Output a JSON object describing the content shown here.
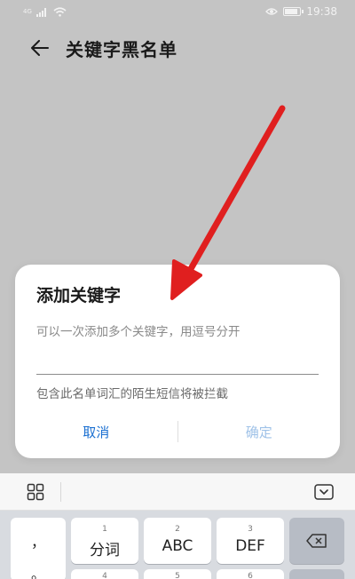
{
  "status_bar": {
    "time": "19:38",
    "signal_label": "4G"
  },
  "header": {
    "title": "关键字黑名单"
  },
  "dialog": {
    "title": "添加关键字",
    "input_placeholder": "可以一次添加多个关键字，用逗号分开",
    "hint": "包含此名单词汇的陌生短信将被拦截",
    "cancel_label": "取消",
    "confirm_label": "确定"
  },
  "keyboard": {
    "punct_top": "，",
    "punct_bottom": "。",
    "keys": [
      {
        "num": "1",
        "label": "分词"
      },
      {
        "num": "2",
        "label": "ABC"
      },
      {
        "num": "3",
        "label": "DEF"
      }
    ],
    "next_row_nums": [
      "4",
      "5",
      "6"
    ]
  },
  "colors": {
    "accent": "#1a6fd1",
    "accent_disabled": "#9fc2e8",
    "annotation_arrow": "#e01f1f"
  }
}
